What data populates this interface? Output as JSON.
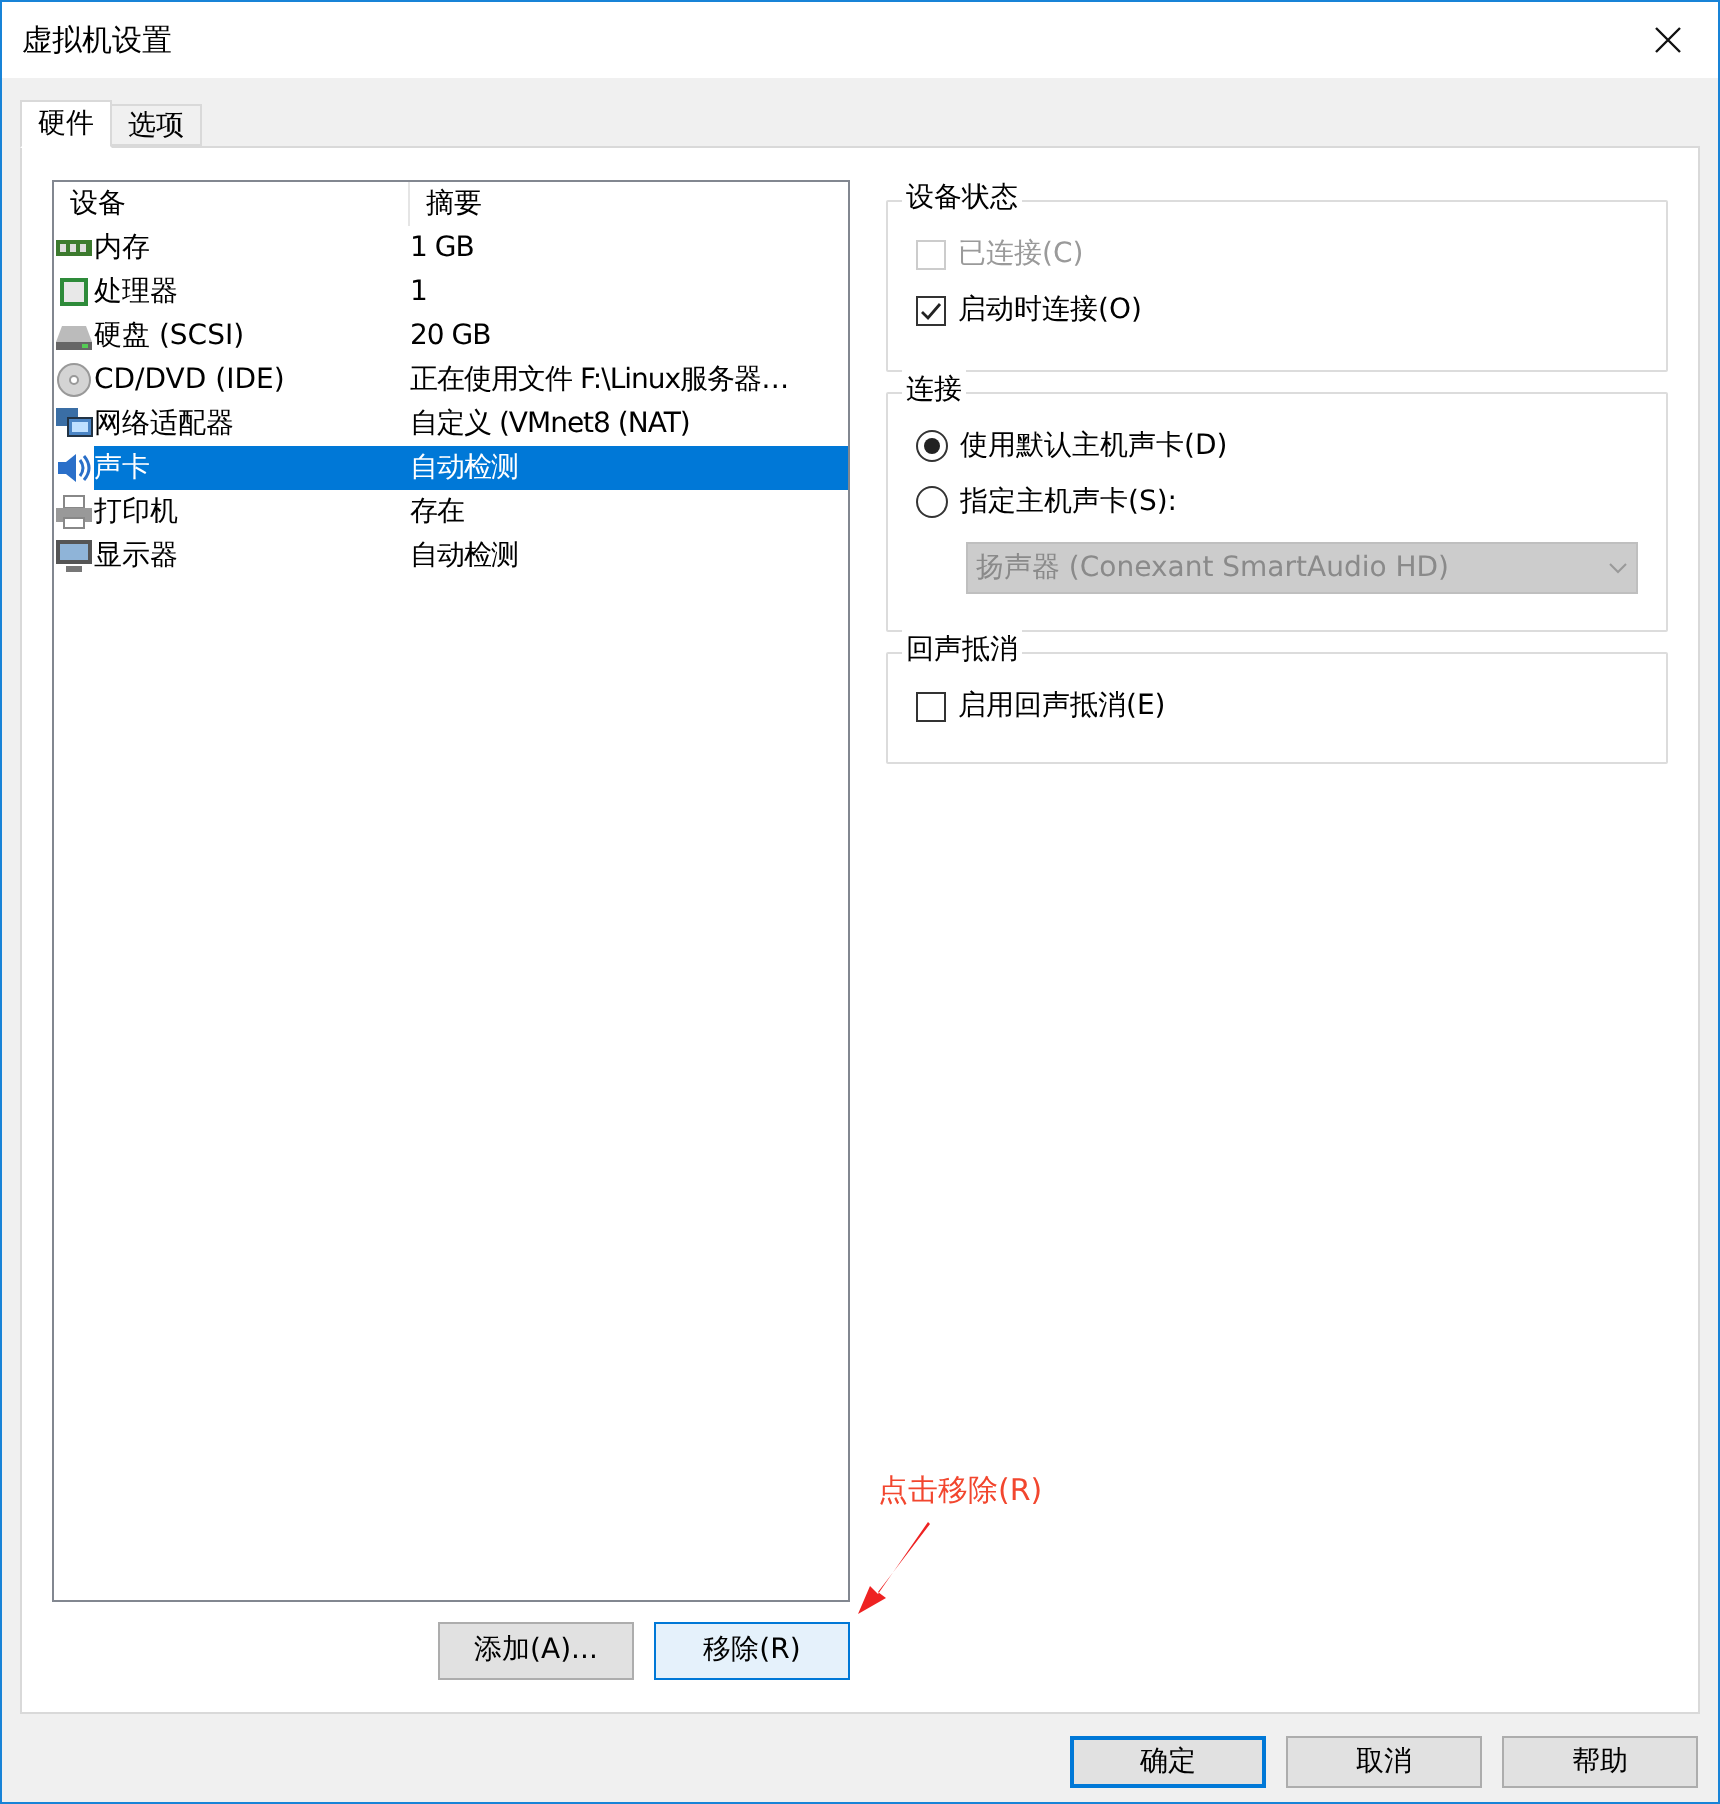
{
  "window": {
    "title": "虚拟机设置"
  },
  "tabs": [
    {
      "label": "硬件",
      "selected": true
    },
    {
      "label": "选项",
      "selected": false
    }
  ],
  "device_list": {
    "columns": [
      "设备",
      "摘要"
    ],
    "rows": [
      {
        "kind": "memory",
        "device": "内存",
        "summary": "1 GB",
        "selected": false
      },
      {
        "kind": "cpu",
        "device": "处理器",
        "summary": "1",
        "selected": false
      },
      {
        "kind": "disk",
        "device": "硬盘 (SCSI)",
        "summary": "20 GB",
        "selected": false
      },
      {
        "kind": "cd",
        "device": "CD/DVD (IDE)",
        "summary": "正在使用文件 F:\\Linux服务器…",
        "selected": false
      },
      {
        "kind": "network",
        "device": "网络适配器",
        "summary": "自定义 (VMnet8 (NAT)",
        "selected": false
      },
      {
        "kind": "sound",
        "device": "声卡",
        "summary": "自动检测",
        "selected": true
      },
      {
        "kind": "printer",
        "device": "打印机",
        "summary": "存在",
        "selected": false
      },
      {
        "kind": "display",
        "device": "显示器",
        "summary": "自动检测",
        "selected": false
      }
    ]
  },
  "list_buttons": [
    {
      "label": "添加(A)...",
      "focused": false
    },
    {
      "label": "移除(R)",
      "focused": true
    }
  ],
  "device_status": {
    "title": "设备状态",
    "options": [
      {
        "label": "已连接(C)",
        "checked": false,
        "disabled": true
      },
      {
        "label": "启动时连接(O)",
        "checked": true,
        "disabled": false
      }
    ]
  },
  "connection": {
    "title": "连接",
    "options": [
      {
        "label": "使用默认主机声卡(D)",
        "selected": true
      },
      {
        "label": "指定主机声卡(S):",
        "selected": false
      }
    ],
    "dropdown": {
      "value": "扬声器 (Conexant SmartAudio HD)",
      "disabled": true
    }
  },
  "echo_cancel": {
    "title": "回声抵消",
    "options": [
      {
        "label": "启用回声抵消(E)",
        "checked": false,
        "disabled": false
      }
    ]
  },
  "annotation": {
    "text": "点击移除(R)"
  },
  "footer_buttons": [
    {
      "label": "确定",
      "focused": true
    },
    {
      "label": "取消",
      "focused": false
    },
    {
      "label": "帮助",
      "focused": false
    }
  ]
}
